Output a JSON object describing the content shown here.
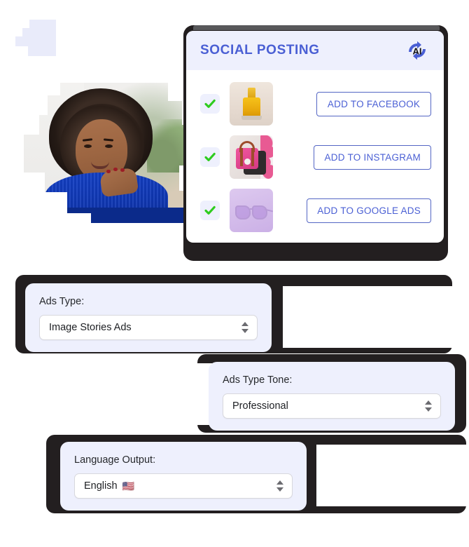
{
  "social_card": {
    "title": "SOCIAL POSTING",
    "ai_badge_label": "AI",
    "ai_badge_icon": "ai-sync-icon",
    "rows": [
      {
        "checked_icon": "green-check-icon",
        "thumb_name": "perfume-bottle-thumbnail",
        "button_label": "ADD TO FACEBOOK"
      },
      {
        "checked_icon": "green-check-icon",
        "thumb_name": "pink-handbag-thumbnail",
        "button_label": "ADD TO INSTAGRAM"
      },
      {
        "checked_icon": "green-check-icon",
        "thumb_name": "purple-sunglasses-thumbnail",
        "button_label": "ADD TO GOOGLE ADS"
      }
    ]
  },
  "fields": [
    {
      "label": "Ads Type:",
      "value": "Image Stories Ads",
      "flag": ""
    },
    {
      "label": "Ads Type Tone:",
      "value": "Professional",
      "flag": ""
    },
    {
      "label": "Language Output:",
      "value": "English",
      "flag": "🇺🇸"
    }
  ],
  "photo": {
    "alt_name": "smiling-woman-blue-sweater-photo"
  },
  "colors": {
    "accent_blue": "#4a5fd4",
    "check_green": "#2ecc1f",
    "card_lavender": "#eef0fd",
    "frame_dark": "#231f20",
    "frame_gray": "#58585a"
  }
}
